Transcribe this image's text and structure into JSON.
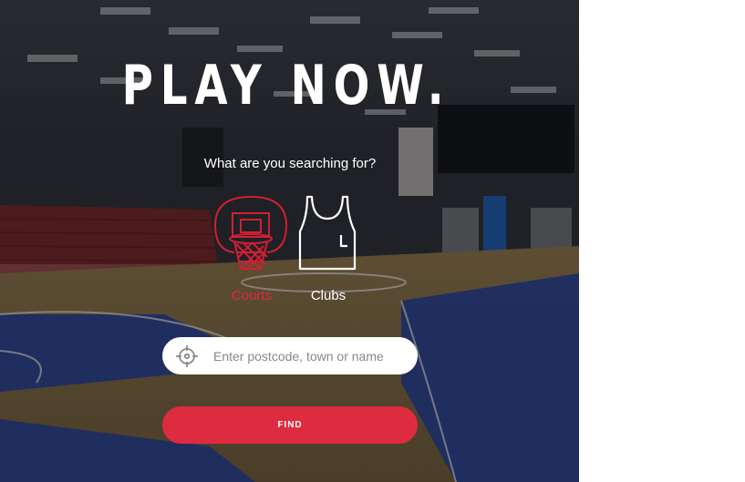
{
  "hero": {
    "title": "PLAY NOW.",
    "subtitle": "What are you searching for?"
  },
  "options": {
    "courts_label": "Courts",
    "clubs_label": "Clubs",
    "selected": "Courts"
  },
  "search": {
    "placeholder": "Enter postcode, town or name",
    "value": ""
  },
  "find_label": "FIND",
  "colors": {
    "accent": "#dd2b3f",
    "text": "#ffffff"
  },
  "icons": [
    "basketball-hoop-icon",
    "jersey-icon",
    "crosshair-location-icon"
  ]
}
